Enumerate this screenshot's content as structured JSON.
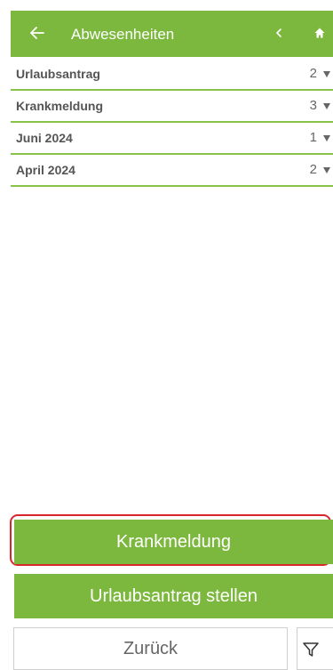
{
  "header": {
    "title": "Abwesenheiten",
    "back_icon": "arrow-left-icon",
    "prev_icon": "chevron-left-icon",
    "home_icon": "home-icon",
    "accent_color": "#7cb83e"
  },
  "groups": [
    {
      "label": "Urlaubsantrag",
      "count": "2"
    },
    {
      "label": "Krankmeldung",
      "count": "3"
    },
    {
      "label": "Juni 2024",
      "count": "1"
    },
    {
      "label": "April 2024",
      "count": "2"
    }
  ],
  "actions": {
    "sick_note_label": "Krankmeldung",
    "vacation_request_label": "Urlaubsantrag stellen",
    "back_label": "Zurück",
    "filter_icon": "filter-icon",
    "highlight_color": "#d9262c"
  }
}
